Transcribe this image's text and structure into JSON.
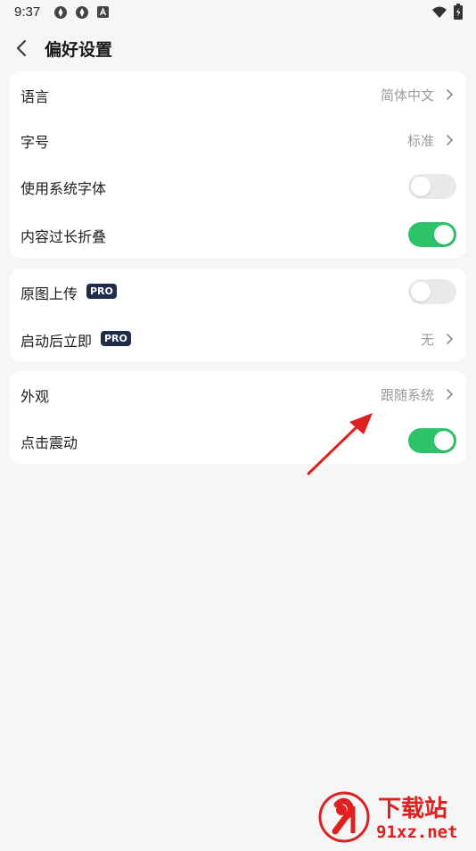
{
  "status_bar": {
    "time": "9:37",
    "notification_icons": [
      "sync-icon",
      "sync-icon",
      "app-a-icon"
    ],
    "system_icons": [
      "wifi-icon",
      "battery-charging-icon"
    ]
  },
  "header": {
    "title": "偏好设置",
    "back_icon": "chevron-left-icon"
  },
  "groups": [
    {
      "rows": [
        {
          "label": "语言",
          "value": "简体中文",
          "control": "chevron"
        },
        {
          "label": "字号",
          "value": "标准",
          "control": "chevron"
        },
        {
          "label": "使用系统字体",
          "control": "toggle",
          "on": false
        },
        {
          "label": "内容过长折叠",
          "control": "toggle",
          "on": true
        }
      ]
    },
    {
      "rows": [
        {
          "label": "原图上传",
          "badge": "PRO",
          "control": "toggle",
          "on": false
        },
        {
          "label": "启动后立即",
          "badge": "PRO",
          "value": "无",
          "control": "chevron"
        }
      ]
    },
    {
      "rows": [
        {
          "label": "外观",
          "value": "跟随系统",
          "control": "chevron"
        },
        {
          "label": "点击震动",
          "control": "toggle",
          "on": true
        }
      ]
    }
  ],
  "colors": {
    "accent": "#2cc36b",
    "pro_badge": "#1f2c4d",
    "background": "#f6f6f6",
    "arrow": "#e0201e"
  },
  "watermark": {
    "brand": "下载站",
    "domain": "91xz.net",
    "logo_mark": "9f"
  }
}
